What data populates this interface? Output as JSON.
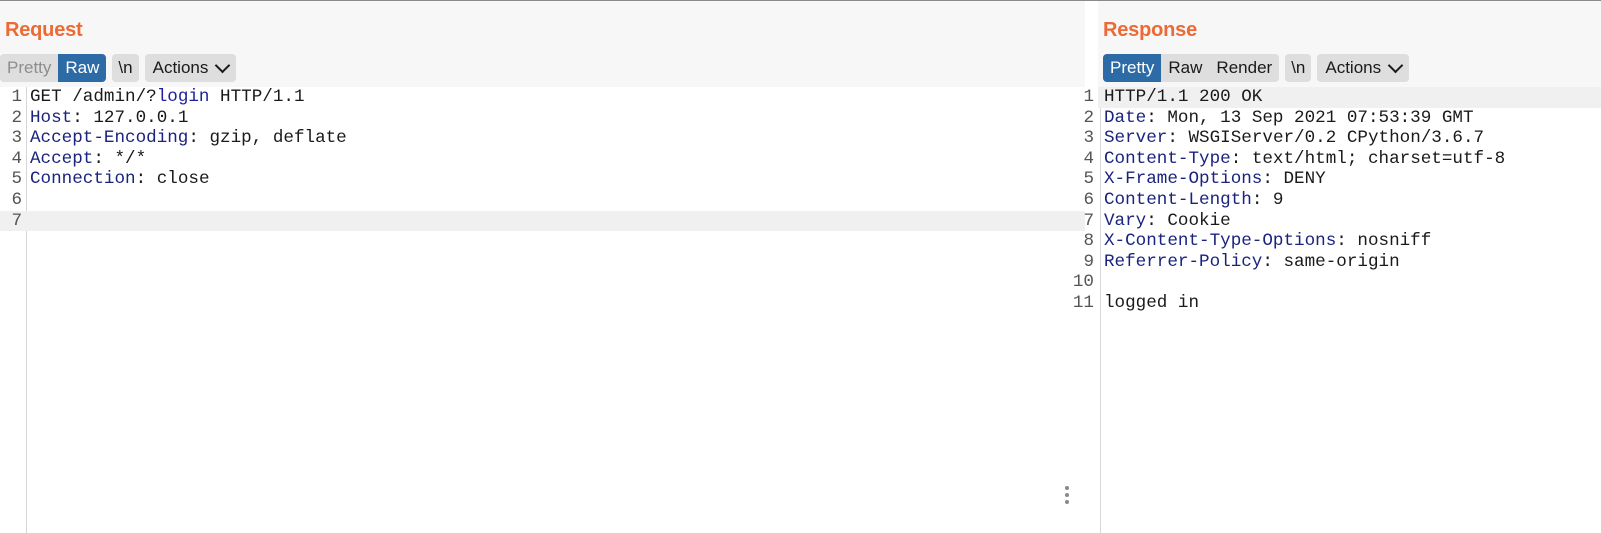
{
  "request": {
    "title": "Request",
    "tabs": {
      "pretty": "Pretty",
      "raw": "Raw",
      "newline": "\\n",
      "actions": "Actions"
    },
    "lines": [
      {
        "num": "1",
        "parts": [
          {
            "t": "GET /admin/?",
            "c": ""
          },
          {
            "t": "login",
            "c": "kw"
          },
          {
            "t": " HTTP/1.1",
            "c": ""
          }
        ]
      },
      {
        "num": "2",
        "parts": [
          {
            "t": "Host",
            "c": "hk"
          },
          {
            "t": ": 127.0.0.1",
            "c": ""
          }
        ]
      },
      {
        "num": "3",
        "parts": [
          {
            "t": "Accept-Encoding",
            "c": "hk"
          },
          {
            "t": ": gzip, deflate",
            "c": ""
          }
        ]
      },
      {
        "num": "4",
        "parts": [
          {
            "t": "Accept",
            "c": "hk"
          },
          {
            "t": ": */*",
            "c": ""
          }
        ]
      },
      {
        "num": "5",
        "parts": [
          {
            "t": "Connection",
            "c": "hk"
          },
          {
            "t": ": close",
            "c": ""
          }
        ]
      },
      {
        "num": "6",
        "parts": []
      },
      {
        "num": "7",
        "parts": [],
        "current": true
      }
    ]
  },
  "response": {
    "title": "Response",
    "tabs": {
      "pretty": "Pretty",
      "raw": "Raw",
      "render": "Render",
      "newline": "\\n",
      "actions": "Actions"
    },
    "lines": [
      {
        "num": "1",
        "parts": [
          {
            "t": "HTTP/1.1 200 OK",
            "c": ""
          }
        ],
        "current": true
      },
      {
        "num": "2",
        "parts": [
          {
            "t": "Date",
            "c": "hk"
          },
          {
            "t": ": Mon, 13 Sep 2021 07:53:39 GMT",
            "c": ""
          }
        ]
      },
      {
        "num": "3",
        "parts": [
          {
            "t": "Server",
            "c": "hk"
          },
          {
            "t": ": WSGIServer/0.2 CPython/3.6.7",
            "c": ""
          }
        ]
      },
      {
        "num": "4",
        "parts": [
          {
            "t": "Content-Type",
            "c": "hk"
          },
          {
            "t": ": text/html; charset=utf-8",
            "c": ""
          }
        ]
      },
      {
        "num": "5",
        "parts": [
          {
            "t": "X-Frame-Options",
            "c": "hk"
          },
          {
            "t": ": DENY",
            "c": ""
          }
        ]
      },
      {
        "num": "6",
        "parts": [
          {
            "t": "Content-Length",
            "c": "hk"
          },
          {
            "t": ": 9",
            "c": ""
          }
        ]
      },
      {
        "num": "7",
        "parts": [
          {
            "t": "Vary",
            "c": "hk"
          },
          {
            "t": ": Cookie",
            "c": ""
          }
        ]
      },
      {
        "num": "8",
        "parts": [
          {
            "t": "X-Content-Type-Options",
            "c": "hk"
          },
          {
            "t": ": nosniff",
            "c": ""
          }
        ]
      },
      {
        "num": "9",
        "parts": [
          {
            "t": "Referrer-Policy",
            "c": "hk"
          },
          {
            "t": ": same-origin",
            "c": ""
          }
        ]
      },
      {
        "num": "10",
        "parts": []
      },
      {
        "num": "11",
        "parts": [
          {
            "t": "logged in",
            "c": ""
          }
        ]
      }
    ]
  },
  "colors": {
    "title": "#ec6a35",
    "active_tab": "#2d6ba6",
    "header_key": "#1a237e"
  }
}
